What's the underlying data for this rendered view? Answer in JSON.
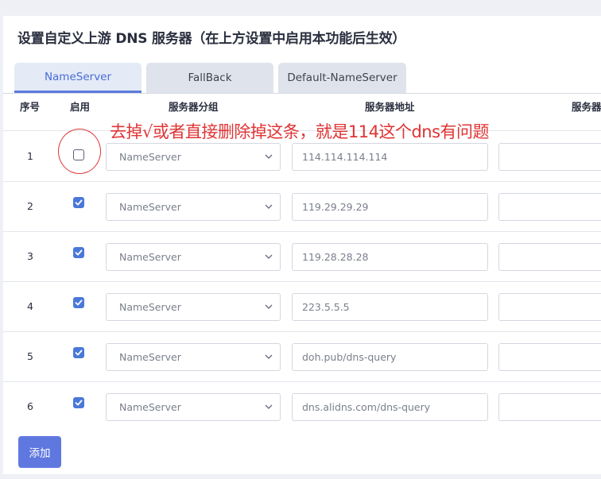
{
  "section_title": "设置自定义上游 DNS 服务器（在上方设置中启用本功能后生效）",
  "tabs": [
    {
      "label": "NameServer",
      "active": true
    },
    {
      "label": "FallBack",
      "active": false
    },
    {
      "label": "Default-NameServer",
      "active": false
    }
  ],
  "table": {
    "headers": [
      "序号",
      "启用",
      "服务器分组",
      "服务器地址",
      "服务器"
    ],
    "rows": [
      {
        "index": "1",
        "enabled": false,
        "group": "NameServer",
        "address": "114.114.114.114"
      },
      {
        "index": "2",
        "enabled": true,
        "group": "NameServer",
        "address": "119.29.29.29"
      },
      {
        "index": "3",
        "enabled": true,
        "group": "NameServer",
        "address": "119.28.28.28"
      },
      {
        "index": "4",
        "enabled": true,
        "group": "NameServer",
        "address": "223.5.5.5"
      },
      {
        "index": "5",
        "enabled": true,
        "group": "NameServer",
        "address": "doh.pub/dns-query"
      },
      {
        "index": "6",
        "enabled": true,
        "group": "NameServer",
        "address": "dns.alidns.com/dns-query"
      }
    ]
  },
  "annotation": "去掉√或者直接删除掉这条，就是114这个dns有问题",
  "add_button": "添加",
  "colors": {
    "accent": "#5f78e0",
    "annotation": "#e03434",
    "checkbox": "#4a78d8"
  }
}
